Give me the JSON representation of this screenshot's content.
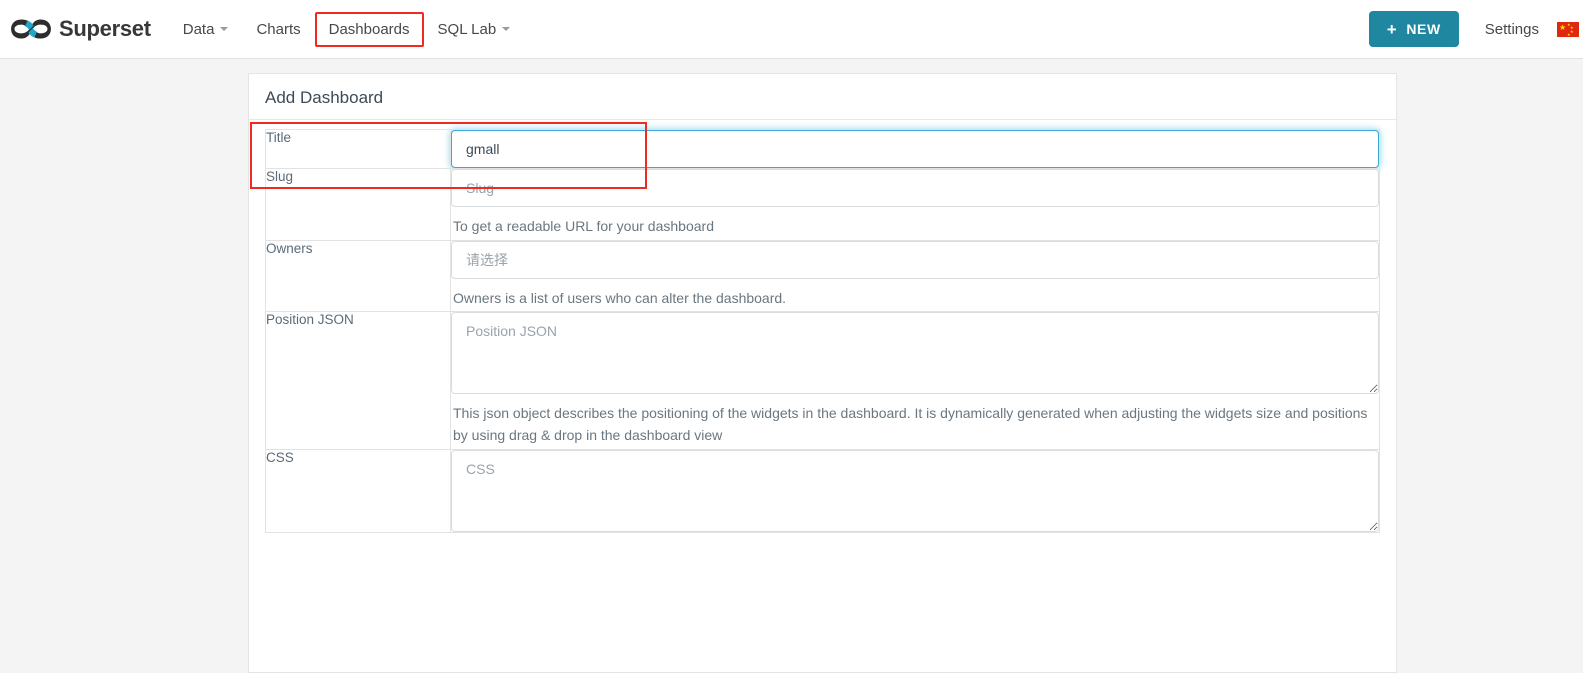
{
  "navbar": {
    "brand": {
      "name": "superset-logo",
      "text": "Superset"
    },
    "links": [
      {
        "label": "Data",
        "name": "nav-item-data",
        "caret": true,
        "highlighted": false
      },
      {
        "label": "Charts",
        "name": "nav-item-charts",
        "caret": false,
        "highlighted": false
      },
      {
        "label": "Dashboards",
        "name": "nav-item-dashboards",
        "caret": false,
        "highlighted": true
      },
      {
        "label": "SQL Lab",
        "name": "nav-item-sql-lab",
        "caret": true,
        "highlighted": false
      }
    ],
    "new_button": {
      "label": "NEW",
      "plus": "+"
    },
    "settings": {
      "label": "Settings"
    },
    "language_flag": "china-flag-icon"
  },
  "panel": {
    "title": "Add Dashboard",
    "rows": [
      {
        "label": "Title",
        "name": "title",
        "type": "text",
        "value": "gmall",
        "placeholder": "Title",
        "focused": true,
        "help": "",
        "highlighted": true
      },
      {
        "label": "Slug",
        "name": "slug",
        "type": "text",
        "value": "",
        "placeholder": "Slug",
        "focused": false,
        "help": "To get a readable URL for your dashboard",
        "highlighted": false
      },
      {
        "label": "Owners",
        "name": "owners",
        "type": "text",
        "value": "",
        "placeholder": "请选择",
        "focused": false,
        "help": "Owners is a list of users who can alter the dashboard.",
        "highlighted": false
      },
      {
        "label": "Position JSON",
        "name": "position-json",
        "type": "textarea",
        "value": "",
        "placeholder": "Position JSON",
        "focused": false,
        "help": "This json object describes the positioning of the widgets in the dashboard. It is dynamically generated when adjusting the widgets size and positions by using drag & drop in the dashboard view",
        "highlighted": false
      },
      {
        "label": "CSS",
        "name": "css",
        "type": "textarea",
        "value": "",
        "placeholder": "CSS",
        "focused": false,
        "help": "",
        "highlighted": false
      }
    ]
  },
  "colors": {
    "accent_teal": "#1f87a0",
    "annotation_red": "#ef2b1f",
    "focus_blue": "#3aa8d2",
    "page_background": "#f4f4f4",
    "panel_background": "#ffffff",
    "label_text": "#5b6b78",
    "help_text": "#6a7780"
  }
}
